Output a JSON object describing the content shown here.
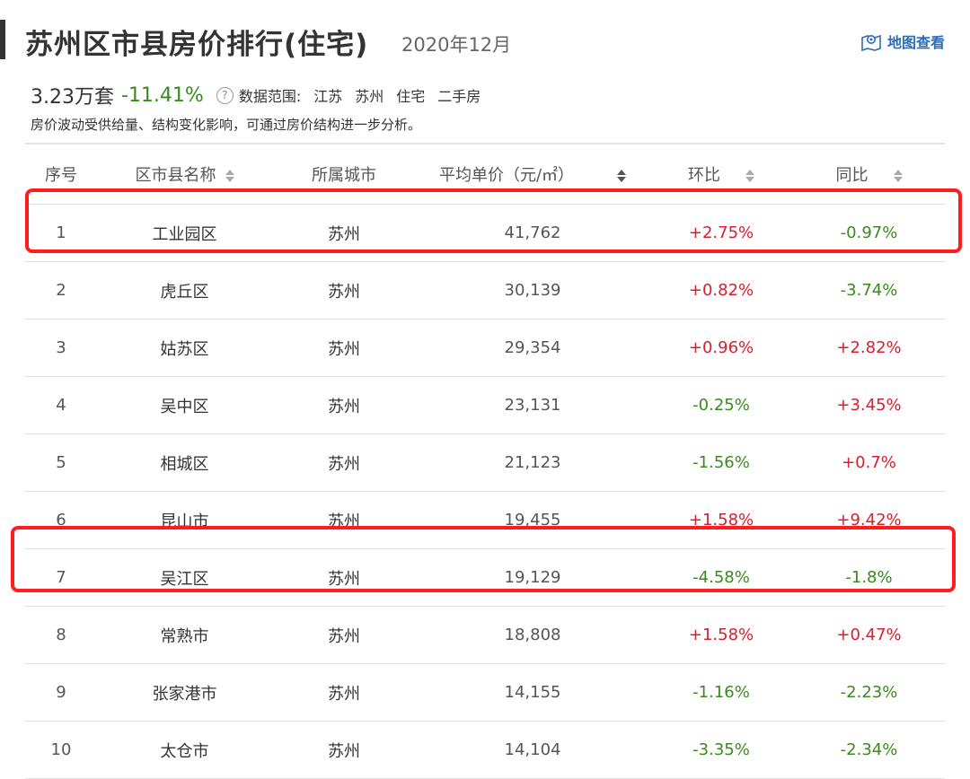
{
  "header": {
    "title": "苏州区市县房价排行(住宅)",
    "date": "2020年12月",
    "map_link": "地图查看"
  },
  "summary": {
    "count": "3.23万套",
    "change": "-11.41%",
    "range_label": "数据范围:",
    "range_values": [
      "江苏",
      "苏州",
      "住宅",
      "二手房"
    ],
    "note": "房价波动受供给量、结构变化影响，可通过房价结构进一步分析。"
  },
  "table": {
    "columns": [
      "序号",
      "区市县名称",
      "所属城市",
      "平均单价（元/㎡）",
      "环比",
      "同比"
    ],
    "rows": [
      {
        "rank": "1",
        "name": "工业园区",
        "city": "苏州",
        "price": "41,762",
        "mom": "+2.75%",
        "yoy": "-0.97%"
      },
      {
        "rank": "2",
        "name": "虎丘区",
        "city": "苏州",
        "price": "30,139",
        "mom": "+0.82%",
        "yoy": "-3.74%"
      },
      {
        "rank": "3",
        "name": "姑苏区",
        "city": "苏州",
        "price": "29,354",
        "mom": "+0.96%",
        "yoy": "+2.82%"
      },
      {
        "rank": "4",
        "name": "吴中区",
        "city": "苏州",
        "price": "23,131",
        "mom": "-0.25%",
        "yoy": "+3.45%"
      },
      {
        "rank": "5",
        "name": "相城区",
        "city": "苏州",
        "price": "21,123",
        "mom": "-1.56%",
        "yoy": "+0.7%"
      },
      {
        "rank": "6",
        "name": "昆山市",
        "city": "苏州",
        "price": "19,455",
        "mom": "+1.58%",
        "yoy": "+9.42%"
      },
      {
        "rank": "7",
        "name": "吴江区",
        "city": "苏州",
        "price": "19,129",
        "mom": "-4.58%",
        "yoy": "-1.8%"
      },
      {
        "rank": "8",
        "name": "常熟市",
        "city": "苏州",
        "price": "18,808",
        "mom": "+1.58%",
        "yoy": "+0.47%"
      },
      {
        "rank": "9",
        "name": "张家港市",
        "city": "苏州",
        "price": "14,155",
        "mom": "-1.16%",
        "yoy": "-2.23%"
      },
      {
        "rank": "10",
        "name": "太仓市",
        "city": "苏州",
        "price": "14,104",
        "mom": "-3.35%",
        "yoy": "-2.34%"
      }
    ]
  },
  "colors": {
    "positive": "#d6202f",
    "negative": "#3a8a1e",
    "highlight": "#ff1d1d",
    "link": "#2a6ebb"
  },
  "highlighted_ranks": [
    "1",
    "7"
  ]
}
